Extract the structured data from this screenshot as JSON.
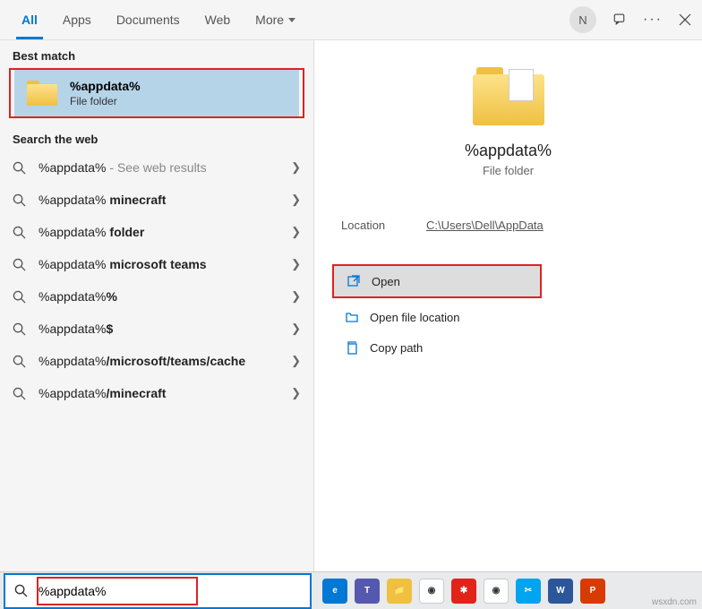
{
  "header": {
    "tabs": [
      {
        "label": "All",
        "active": true
      },
      {
        "label": "Apps",
        "active": false
      },
      {
        "label": "Documents",
        "active": false
      },
      {
        "label": "Web",
        "active": false
      },
      {
        "label": "More",
        "active": false,
        "hasChevron": true
      }
    ],
    "avatar_initial": "N"
  },
  "left": {
    "best_match_label": "Best match",
    "best_match": {
      "title": "%appdata%",
      "subtitle": "File folder"
    },
    "search_web_label": "Search the web",
    "results": [
      {
        "prefix": "%appdata%",
        "bold": "",
        "suffix": " - See web results",
        "muted": true
      },
      {
        "prefix": "%appdata% ",
        "bold": "minecraft",
        "suffix": ""
      },
      {
        "prefix": "%appdata% ",
        "bold": "folder",
        "suffix": ""
      },
      {
        "prefix": "%appdata% ",
        "bold": "microsoft teams",
        "suffix": ""
      },
      {
        "prefix": "%appdata%",
        "bold": "%",
        "suffix": ""
      },
      {
        "prefix": "%appdata%",
        "bold": "$",
        "suffix": ""
      },
      {
        "prefix": "%appdata%",
        "bold": "/microsoft/teams/cache",
        "suffix": ""
      },
      {
        "prefix": "%appdata%",
        "bold": "/minecraft",
        "suffix": ""
      }
    ]
  },
  "right": {
    "title": "%appdata%",
    "subtitle": "File folder",
    "location_label": "Location",
    "location_value": "C:\\Users\\Dell\\AppData",
    "actions": [
      {
        "label": "Open",
        "icon": "open",
        "highlight": true
      },
      {
        "label": "Open file location",
        "icon": "folder"
      },
      {
        "label": "Copy path",
        "icon": "copy"
      }
    ]
  },
  "taskbar": {
    "search_value": "%appdata%"
  },
  "watermark": "wsxdn.com"
}
